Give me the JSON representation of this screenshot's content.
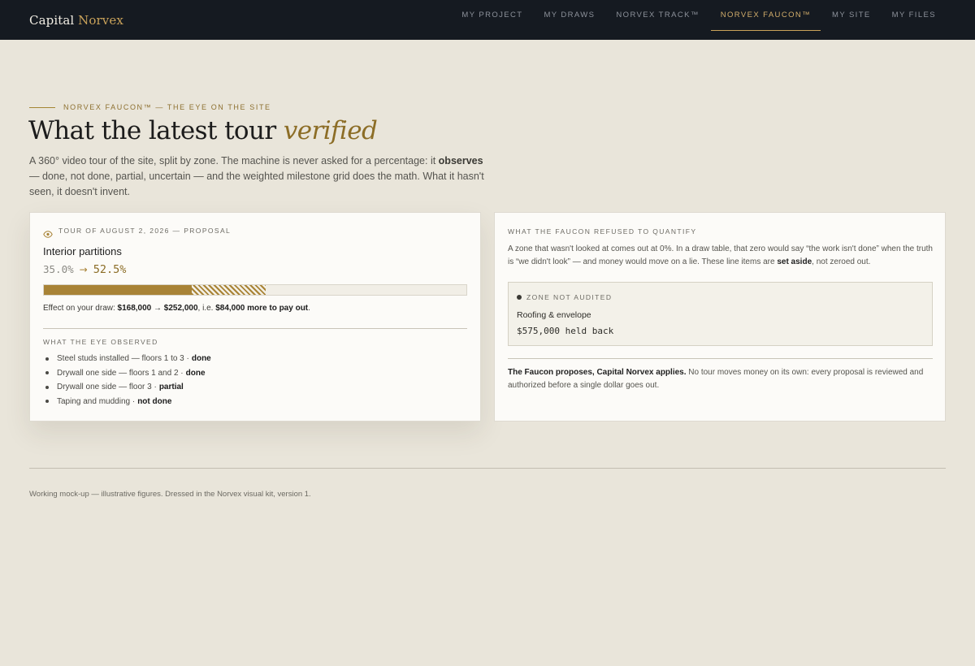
{
  "brand": {
    "name": "Capital",
    "accent": "Norvex"
  },
  "nav": [
    {
      "label": "MY PROJECT",
      "active": false
    },
    {
      "label": "MY DRAWS",
      "active": false
    },
    {
      "label": "NORVEX TRACK™",
      "active": false
    },
    {
      "label": "NORVEX FAUCON™",
      "active": true
    },
    {
      "label": "MY SITE",
      "active": false
    },
    {
      "label": "MY FILES",
      "active": false
    }
  ],
  "hero": {
    "eyebrow": "NORVEX FAUCON™ — THE EYE ON THE SITE",
    "title_main": "What the latest tour ",
    "title_emphasis": "verified",
    "lead_before": "A 360° video tour of the site, split by zone. The machine is never asked for a percentage: it ",
    "lead_bold": "observes",
    "lead_after": " — done, not done, partial, uncertain — and the weighted milestone grid does the math. What it hasn't seen, it doesn't invent."
  },
  "tour_card": {
    "icon": "eye-icon",
    "kicker": "TOUR OF AUGUST 2, 2026 — PROPOSAL",
    "zone": "Interior partitions",
    "from_pct": "35.0%",
    "arrow": "→",
    "to_pct": "52.5%",
    "progress": {
      "confirmed": 0.35,
      "proposed": 0.525
    },
    "effect": {
      "prefix": "Effect on your draw: ",
      "change": "$168,000 → $252,000",
      "middle": ", i.e. ",
      "more": "$84,000 more to pay out",
      "suffix": "."
    },
    "observed_title": "WHAT THE EYE OBSERVED",
    "observations": [
      {
        "text": "Steel studs installed — floors 1 to 3 ·",
        "status": "done"
      },
      {
        "text": "Drywall one side — floors 1 and 2 ·",
        "status": "done"
      },
      {
        "text": "Drywall one side — floor 3 ·",
        "status": "partial"
      },
      {
        "text": "Taping and mudding ·",
        "status": "not done"
      }
    ]
  },
  "refused_card": {
    "kicker": "WHAT THE FAUCON REFUSED TO QUANTIFY",
    "text_before": "A zone that wasn't looked at comes out at 0%. In a draw table, that zero would say “the work isn't done” when the truth is “we didn't look” — and money would move on a lie. These line items are ",
    "text_bold": "set aside",
    "text_after": ", not zeroed out.",
    "audit_label": "ZONE NOT AUDITED",
    "audit_zone": "Roofing & envelope",
    "audit_amount": "$575,000 held back",
    "footnote_bold": "The Faucon proposes, Capital Norvex applies.",
    "footnote_text": " No tour moves money on its own: every proposal is reviewed and authorized before a single dollar goes out."
  },
  "footer": "Working mock-up — illustrative figures. Dressed in the Norvex visual kit, version 1.",
  "colors": {
    "accent": "#a88336",
    "nav_bg": "#151a21",
    "page_bg": "#e9e5da"
  }
}
